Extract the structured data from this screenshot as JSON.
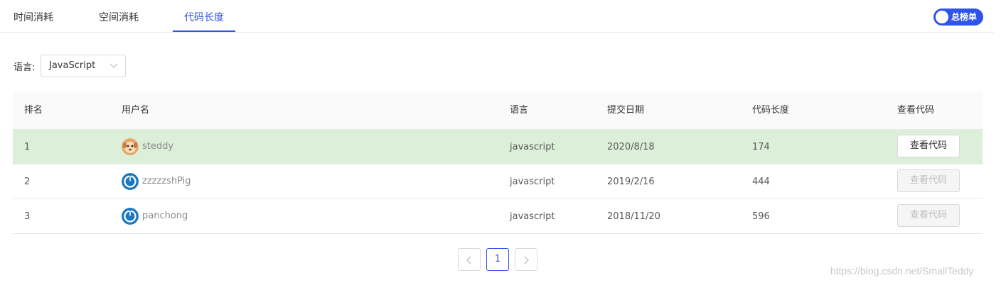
{
  "tabs": [
    {
      "label": "时间消耗"
    },
    {
      "label": "空间消耗"
    },
    {
      "label": "代码长度"
    }
  ],
  "active_tab": "代码长度",
  "toggle": {
    "label": "总榜单",
    "on": true
  },
  "filter": {
    "label": "语言:",
    "selected": "JavaScript"
  },
  "table": {
    "headers": {
      "rank": "排名",
      "user": "用户名",
      "lang": "语言",
      "date": "提交日期",
      "len": "代码长度",
      "view": "查看代码"
    },
    "rows": [
      {
        "rank": "1",
        "user": "steddy",
        "lang": "javascript",
        "date": "2020/8/18",
        "len": "174",
        "view": "查看代码",
        "highlighted": true,
        "view_enabled": true
      },
      {
        "rank": "2",
        "user": "zzzzzshPig",
        "lang": "javascript",
        "date": "2019/2/16",
        "len": "444",
        "view": "查看代码",
        "highlighted": false,
        "view_enabled": false
      },
      {
        "rank": "3",
        "user": "panchong",
        "lang": "javascript",
        "date": "2018/11/20",
        "len": "596",
        "view": "查看代码",
        "highlighted": false,
        "view_enabled": false
      }
    ]
  },
  "pagination": {
    "current": "1"
  },
  "watermark": "https://blog.csdn.net/SmallTeddy",
  "colors": {
    "accent": "#2f54eb",
    "highlight_row": "#dcefd8"
  }
}
